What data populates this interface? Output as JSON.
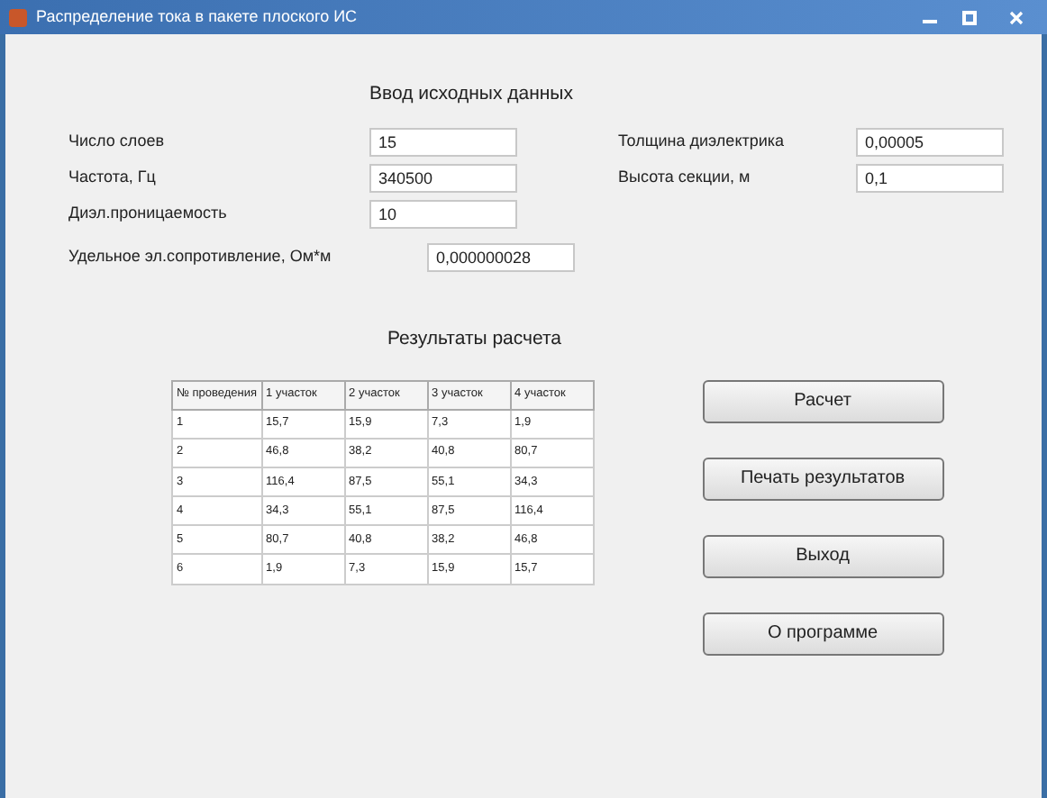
{
  "window": {
    "title": "Распределение тока в пакете плоского ИС"
  },
  "input_section": {
    "heading": "Ввод исходных данных",
    "fields": [
      {
        "label": "Число слоев",
        "value": "15"
      },
      {
        "label": "Частота, Гц",
        "value": "340500"
      },
      {
        "label": "Диэл.проницаемость",
        "value": "10"
      },
      {
        "label": "Удельное эл.сопротивление, Ом*м",
        "value": "0,000000028"
      },
      {
        "label": "Толщина диэлектрика",
        "value": "0,00005"
      },
      {
        "label": "Высота секции, м",
        "value": "0,1"
      }
    ]
  },
  "results": {
    "heading": "Результаты расчета",
    "columns": [
      "№ проведения",
      "1 участок",
      "2 участок",
      "3 участок",
      "4 участок"
    ],
    "rows": [
      [
        "1",
        "15,7",
        "15,9",
        "7,3",
        "1,9"
      ],
      [
        "2",
        "46,8",
        "38,2",
        "40,8",
        "80,7"
      ],
      [
        "3",
        "116,4",
        "87,5",
        "55,1",
        "34,3"
      ],
      [
        "4",
        "34,3",
        "55,1",
        "87,5",
        "116,4"
      ],
      [
        "5",
        "80,7",
        "40,8",
        "38,2",
        "46,8"
      ],
      [
        "6",
        "1,9",
        "7,3",
        "15,9",
        "15,7"
      ]
    ]
  },
  "buttons": [
    "Расчет",
    "Печать результатов",
    "Выход",
    "О программе"
  ]
}
